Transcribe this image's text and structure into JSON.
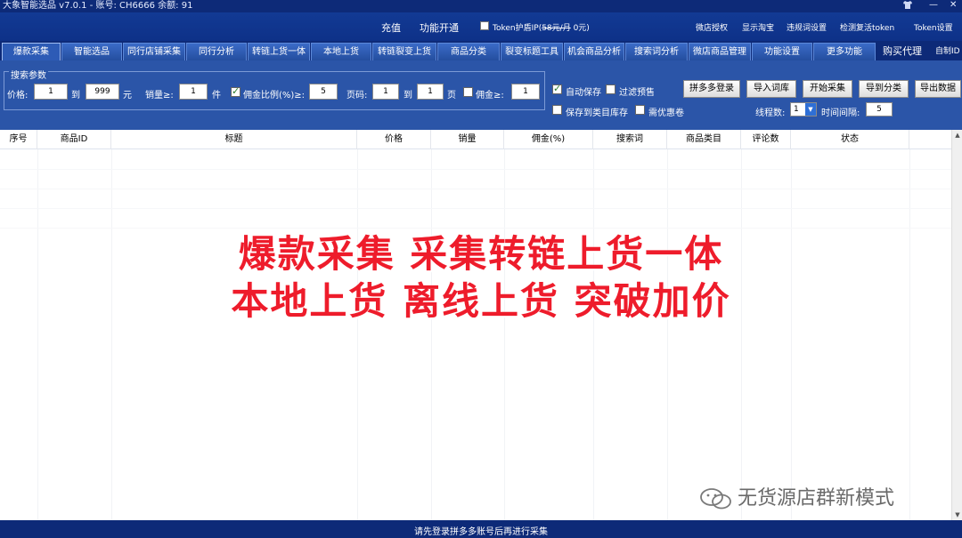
{
  "window": {
    "title": "大象智能选品 v7.0.1 - 账号: CH6666 余额: 91",
    "controls": [
      "shirt-icon",
      "minimize",
      "close"
    ]
  },
  "top_menu": {
    "recharge": "充值",
    "activate": "功能开通",
    "token_shield_label": "Token护盾IP(",
    "token_shield_old_price": "58元/月",
    "token_shield_new_price": " 0元)",
    "shop_auth": "微店授权",
    "show_taobao": "显示淘宝",
    "violation_settings": "违规词设置",
    "check_token": "检测复活token",
    "token_settings": "Token设置"
  },
  "tabs": [
    {
      "label": "爆款采集",
      "active": true
    },
    {
      "label": "智能选品"
    },
    {
      "label": "同行店铺采集"
    },
    {
      "label": "同行分析"
    },
    {
      "label": "转链上货一体"
    },
    {
      "label": "本地上货"
    },
    {
      "label": "转链裂变上货"
    },
    {
      "label": "商品分类"
    },
    {
      "label": "裂变标题工具"
    },
    {
      "label": "机会商品分析"
    },
    {
      "label": "搜索词分析"
    },
    {
      "label": "微店商品管理"
    },
    {
      "label": "功能设置"
    },
    {
      "label": "更多功能"
    }
  ],
  "tab_extras": {
    "buy_agent": "购买代理",
    "custom": "自制ID"
  },
  "search": {
    "group_title": "搜索参数",
    "price_label": "价格:",
    "price_min": "1",
    "to1": "到",
    "price_max": "999",
    "yuan": "元",
    "sales_label": "销量≥:",
    "sales_min": "1",
    "unit": "件",
    "commission_ratio_label": "佣金比例(%)≥:",
    "commission_ratio": "5",
    "commission_ratio_checked": true,
    "page_label": "页码:",
    "page_from": "1",
    "to2": "到",
    "page_to": "1",
    "page_unit": "页",
    "commission_label": "佣金≥:",
    "commission": "1",
    "commission_checked": false
  },
  "options": {
    "auto_save": "自动保存",
    "auto_save_checked": true,
    "filter_presale": "过滤预售",
    "filter_presale_checked": false,
    "save_to_category": "保存到类目库存",
    "save_to_category_checked": false,
    "need_coupon": "需优惠卷",
    "need_coupon_checked": false
  },
  "actions": {
    "pdd_login": "拼多多登录",
    "import_words": "导入词库",
    "start_collect": "开始采集",
    "export_category": "导到分类",
    "export_data": "导出数据",
    "threads_label": "线程数:",
    "threads_value": "1",
    "interval_label": "时间间隔:",
    "interval_value": "5"
  },
  "table": {
    "columns": [
      "序号",
      "商品ID",
      "标题",
      "价格",
      "销量",
      "佣金(%)",
      "搜索词",
      "商品类目",
      "评论数",
      "状态"
    ]
  },
  "overlay": {
    "line1": "爆款采集 采集转链上货一体",
    "line2": "本地上货 离线上货 突破加价"
  },
  "watermark": "无货源店群新模式",
  "status": "请先登录拼多多账号后再进行采集",
  "colors": {
    "title_bar": "#0d2a78",
    "panel": "#2b55a8",
    "overlay_text": "#ee1c2b"
  }
}
